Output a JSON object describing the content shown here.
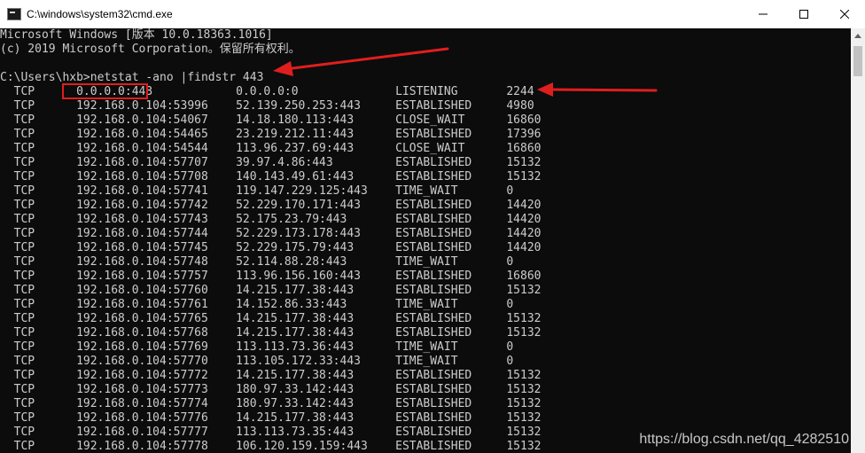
{
  "window": {
    "title": "C:\\windows\\system32\\cmd.exe",
    "icon": "cmd-icon",
    "buttons": {
      "minimize": "minimize-icon",
      "maximize": "maximize-icon",
      "close": "close-icon"
    }
  },
  "console": {
    "header_lines": [
      "Microsoft Windows [版本 10.0.18363.1016]",
      "(c) 2019 Microsoft Corporation。保留所有权利。",
      ""
    ],
    "command_line": "C:\\Users\\hxb>netstat -ano |findstr 443",
    "rows": [
      {
        "proto": "TCP",
        "local": "0.0.0.0:443",
        "foreign": "0.0.0.0:0",
        "state": "LISTENING",
        "pid": "2244"
      },
      {
        "proto": "TCP",
        "local": "192.168.0.104:53996",
        "foreign": "52.139.250.253:443",
        "state": "ESTABLISHED",
        "pid": "4980"
      },
      {
        "proto": "TCP",
        "local": "192.168.0.104:54067",
        "foreign": "14.18.180.113:443",
        "state": "CLOSE_WAIT",
        "pid": "16860"
      },
      {
        "proto": "TCP",
        "local": "192.168.0.104:54465",
        "foreign": "23.219.212.11:443",
        "state": "ESTABLISHED",
        "pid": "17396"
      },
      {
        "proto": "TCP",
        "local": "192.168.0.104:54544",
        "foreign": "113.96.237.69:443",
        "state": "CLOSE_WAIT",
        "pid": "16860"
      },
      {
        "proto": "TCP",
        "local": "192.168.0.104:57707",
        "foreign": "39.97.4.86:443",
        "state": "ESTABLISHED",
        "pid": "15132"
      },
      {
        "proto": "TCP",
        "local": "192.168.0.104:57708",
        "foreign": "140.143.49.61:443",
        "state": "ESTABLISHED",
        "pid": "15132"
      },
      {
        "proto": "TCP",
        "local": "192.168.0.104:57741",
        "foreign": "119.147.229.125:443",
        "state": "TIME_WAIT",
        "pid": "0"
      },
      {
        "proto": "TCP",
        "local": "192.168.0.104:57742",
        "foreign": "52.229.170.171:443",
        "state": "ESTABLISHED",
        "pid": "14420"
      },
      {
        "proto": "TCP",
        "local": "192.168.0.104:57743",
        "foreign": "52.175.23.79:443",
        "state": "ESTABLISHED",
        "pid": "14420"
      },
      {
        "proto": "TCP",
        "local": "192.168.0.104:57744",
        "foreign": "52.229.173.178:443",
        "state": "ESTABLISHED",
        "pid": "14420"
      },
      {
        "proto": "TCP",
        "local": "192.168.0.104:57745",
        "foreign": "52.229.175.79:443",
        "state": "ESTABLISHED",
        "pid": "14420"
      },
      {
        "proto": "TCP",
        "local": "192.168.0.104:57748",
        "foreign": "52.114.88.28:443",
        "state": "TIME_WAIT",
        "pid": "0"
      },
      {
        "proto": "TCP",
        "local": "192.168.0.104:57757",
        "foreign": "113.96.156.160:443",
        "state": "ESTABLISHED",
        "pid": "16860"
      },
      {
        "proto": "TCP",
        "local": "192.168.0.104:57760",
        "foreign": "14.215.177.38:443",
        "state": "ESTABLISHED",
        "pid": "15132"
      },
      {
        "proto": "TCP",
        "local": "192.168.0.104:57761",
        "foreign": "14.152.86.33:443",
        "state": "TIME_WAIT",
        "pid": "0"
      },
      {
        "proto": "TCP",
        "local": "192.168.0.104:57765",
        "foreign": "14.215.177.38:443",
        "state": "ESTABLISHED",
        "pid": "15132"
      },
      {
        "proto": "TCP",
        "local": "192.168.0.104:57768",
        "foreign": "14.215.177.38:443",
        "state": "ESTABLISHED",
        "pid": "15132"
      },
      {
        "proto": "TCP",
        "local": "192.168.0.104:57769",
        "foreign": "113.113.73.36:443",
        "state": "TIME_WAIT",
        "pid": "0"
      },
      {
        "proto": "TCP",
        "local": "192.168.0.104:57770",
        "foreign": "113.105.172.33:443",
        "state": "TIME_WAIT",
        "pid": "0"
      },
      {
        "proto": "TCP",
        "local": "192.168.0.104:57772",
        "foreign": "14.215.177.38:443",
        "state": "ESTABLISHED",
        "pid": "15132"
      },
      {
        "proto": "TCP",
        "local": "192.168.0.104:57773",
        "foreign": "180.97.33.142:443",
        "state": "ESTABLISHED",
        "pid": "15132"
      },
      {
        "proto": "TCP",
        "local": "192.168.0.104:57774",
        "foreign": "180.97.33.142:443",
        "state": "ESTABLISHED",
        "pid": "15132"
      },
      {
        "proto": "TCP",
        "local": "192.168.0.104:57776",
        "foreign": "14.215.177.38:443",
        "state": "ESTABLISHED",
        "pid": "15132"
      },
      {
        "proto": "TCP",
        "local": "192.168.0.104:57777",
        "foreign": "113.113.73.35:443",
        "state": "ESTABLISHED",
        "pid": "15132"
      },
      {
        "proto": "TCP",
        "local": "192.168.0.104:57778",
        "foreign": "106.120.159.159:443",
        "state": "ESTABLISHED",
        "pid": "15132"
      }
    ]
  },
  "annotations": {
    "box_color": "#e01e1e",
    "arrow_color": "#e01e1e"
  },
  "watermark": "https://blog.csdn.net/qq_4282510",
  "colors": {
    "console_bg": "#0c0c0c",
    "console_fg": "#cccccc",
    "titlebar_bg": "#ffffff"
  }
}
